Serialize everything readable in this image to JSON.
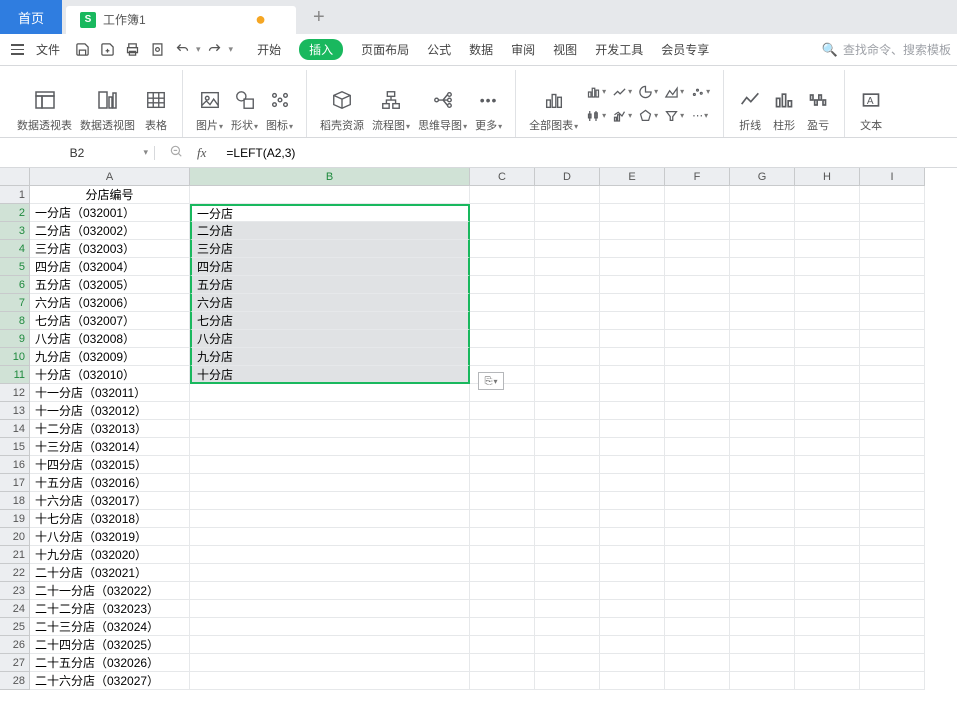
{
  "tabs": {
    "home": "首页",
    "doc": "工作簿1",
    "s_icon": "S"
  },
  "menu": {
    "file": "文件",
    "items": [
      "开始",
      "插入",
      "页面布局",
      "公式",
      "数据",
      "审阅",
      "视图",
      "开发工具",
      "会员专享"
    ],
    "active_index": 1,
    "search_placeholder": "查找命令、搜索模板"
  },
  "ribbon": {
    "pivot_table": "数据透视表",
    "pivot_view": "数据透视图",
    "table": "表格",
    "picture": "图片",
    "shape": "形状",
    "icon_lib": "图标",
    "docer": "稻壳资源",
    "flowchart": "流程图",
    "mindmap": "思维导图",
    "more": "更多",
    "all_charts": "全部图表",
    "line": "折线",
    "bar": "柱形",
    "winloss": "盈亏",
    "textbox": "文本"
  },
  "name_box": "B2",
  "formula": "=LEFT(A2,3)",
  "sheet": {
    "col_headers": [
      "A",
      "B",
      "C",
      "D",
      "E",
      "F",
      "G",
      "H",
      "I"
    ],
    "header_cell_A1": "分店编号",
    "rows_A": [
      "一分店（032001）",
      "二分店（032002）",
      "三分店（032003）",
      "四分店（032004）",
      "五分店（032005）",
      "六分店（032006）",
      "七分店（032007）",
      "八分店（032008）",
      "九分店（032009）",
      "十分店（032010）",
      "十一分店（032011）",
      "十一分店（032012）",
      "十二分店（032013）",
      "十三分店（032014）",
      "十四分店（032015）",
      "十五分店（032016）",
      "十六分店（032017）",
      "十七分店（032018）",
      "十八分店（032019）",
      "十九分店（032020）",
      "二十分店（032021）",
      "二十一分店（032022）",
      "二十二分店（032023）",
      "二十三分店（032024）",
      "二十四分店（032025）",
      "二十五分店（032026）",
      "二十六分店（032027）"
    ],
    "rows_B": [
      "一分店",
      "二分店",
      "三分店",
      "四分店",
      "五分店",
      "六分店",
      "七分店",
      "八分店",
      "九分店",
      "十分店"
    ]
  }
}
